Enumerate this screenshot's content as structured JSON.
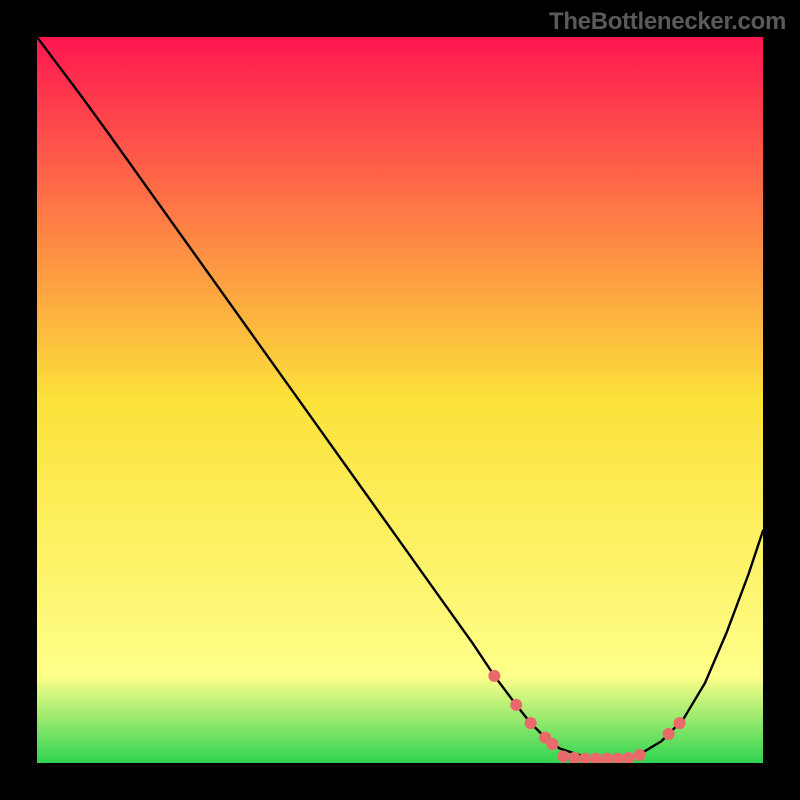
{
  "attribution": "TheBottlenecker.com",
  "chart_data": {
    "type": "line",
    "title": "",
    "xlabel": "",
    "ylabel": "",
    "xlim": [
      0,
      100
    ],
    "ylim": [
      0,
      100
    ],
    "grid": false,
    "legend": false,
    "gradient_stops": [
      {
        "offset": 0,
        "color": "#ff1750"
      },
      {
        "offset": 50,
        "color": "#fce23a"
      },
      {
        "offset": 88,
        "color": "#feff8a"
      },
      {
        "offset": 100,
        "color": "#2fd351"
      }
    ],
    "series": [
      {
        "name": "curve",
        "x": [
          0,
          3,
          6,
          10,
          15,
          20,
          25,
          30,
          35,
          40,
          45,
          50,
          55,
          60,
          63,
          66,
          68,
          70,
          72,
          75,
          78,
          81,
          83,
          86,
          89,
          92,
          95,
          98,
          100
        ],
        "y": [
          100,
          96,
          92,
          86.5,
          79.5,
          72.5,
          65.5,
          58.5,
          51.5,
          44.5,
          37.5,
          30.5,
          23.5,
          16.5,
          12,
          8,
          5.5,
          3.5,
          2,
          1,
          0.6,
          0.6,
          1.2,
          3,
          6,
          11,
          18,
          26,
          32
        ],
        "stroke": "#000000",
        "stroke_width": 2.4
      }
    ],
    "markers": {
      "name": "bottom-dots",
      "color": "#e86a6a",
      "radius": 6,
      "points_xy": [
        [
          63,
          12
        ],
        [
          66,
          8
        ],
        [
          68,
          5.5
        ],
        [
          70,
          3.5
        ],
        [
          71,
          2.6
        ],
        [
          72.5,
          0.9
        ],
        [
          74,
          0.7
        ],
        [
          75.5,
          0.6
        ],
        [
          77,
          0.6
        ],
        [
          78.5,
          0.6
        ],
        [
          80,
          0.6
        ],
        [
          81.5,
          0.7
        ],
        [
          83,
          1.1
        ],
        [
          87,
          4
        ],
        [
          88.5,
          5.5
        ]
      ]
    }
  }
}
